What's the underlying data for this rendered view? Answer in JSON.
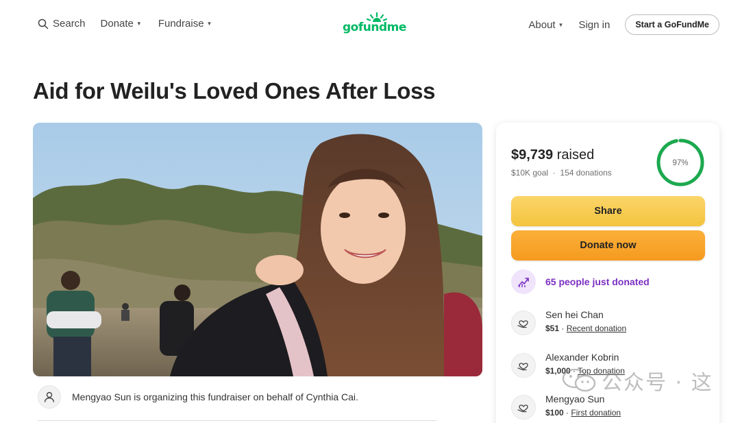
{
  "nav": {
    "search_label": "Search",
    "donate_label": "Donate",
    "fundraise_label": "Fundraise",
    "logo_text": "gofundme",
    "about_label": "About",
    "signin_label": "Sign in",
    "start_label": "Start a GoFundMe",
    "caret_icon": "chevron-down-icon"
  },
  "page": {
    "title": "Aid for Weilu's Loved Ones After Loss"
  },
  "organizer": {
    "text": "Mengyao Sun is organizing this fundraiser on behalf of Cynthia Cai."
  },
  "card": {
    "raised_amount": "$9,739",
    "raised_word": "raised",
    "goal": "$10K goal",
    "separator": "·",
    "donations": "154 donations",
    "percent_label": "97%",
    "percent_value": 0.97,
    "share_label": "Share",
    "donate_label": "Donate now",
    "just_donated": "65 people just donated",
    "donors": [
      {
        "name": "Sen hei Chan",
        "amount": "$51",
        "sep": "·",
        "tag": "Recent donation"
      },
      {
        "name": "Alexander Kobrin",
        "amount": "$1,000",
        "sep": "·",
        "tag": "Top donation"
      },
      {
        "name": "Mengyao Sun",
        "amount": "$100",
        "sep": "·",
        "tag": "First donation"
      }
    ]
  },
  "watermark": {
    "text": "公众号 · 这"
  },
  "colors": {
    "brand_green": "#00b964",
    "share_yellow": "#f7cc4f",
    "donate_orange": "#f8a52d",
    "purple": "#7b2fc2"
  }
}
